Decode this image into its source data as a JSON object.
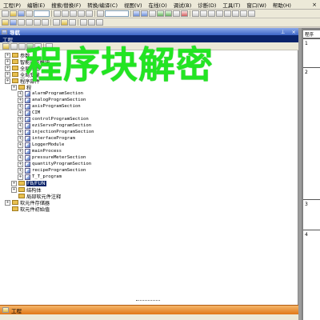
{
  "menubar": {
    "items": [
      "工程(P)",
      "编辑(E)",
      "搜索/替换(F)",
      "转换/编译(C)",
      "视图(V)",
      "在线(O)",
      "调试(B)",
      "诊断(D)",
      "工具(T)",
      "窗口(W)",
      "帮助(H)"
    ],
    "close": "×"
  },
  "nav": {
    "title": "导航",
    "pin": "⊥",
    "close": "×",
    "project_label": "工程"
  },
  "tree": {
    "nodes": [
      {
        "label": "参数",
        "mono": false
      },
      {
        "label": "智能功能模块",
        "mono": false
      },
      {
        "label": "全局标签",
        "mono": false
      },
      {
        "label": "全局变量",
        "mono": false
      },
      {
        "label": "程序部件",
        "mono": false
      },
      {
        "label": "程",
        "mono": false
      },
      {
        "label": "alarmProgramSection",
        "mono": true
      },
      {
        "label": "analogProgramSection",
        "mono": true
      },
      {
        "label": "axisProgramSection",
        "mono": true
      },
      {
        "label": "CIM",
        "mono": true
      },
      {
        "label": "controlProgramSection",
        "mono": true
      },
      {
        "label": "eziServoProgramSection",
        "mono": true
      },
      {
        "label": "injectionProgramSection",
        "mono": true
      },
      {
        "label": "interfaceProgram",
        "mono": true
      },
      {
        "label": "LoggerModule",
        "mono": true
      },
      {
        "label": "mainProcess",
        "mono": true
      },
      {
        "label": "pressureMeterSection",
        "mono": true
      },
      {
        "label": "quantityProgramSection",
        "mono": true
      },
      {
        "label": "recipeProgramSection",
        "mono": true
      },
      {
        "label": "T_T_program",
        "mono": true
      },
      {
        "label": "FB/FUN",
        "mono": false
      },
      {
        "label": "结构体",
        "mono": false
      },
      {
        "label": "局部软元件注释",
        "mono": false
      },
      {
        "label": "软元件存储器",
        "mono": false
      },
      {
        "label": "软元件初始值",
        "mono": false
      }
    ]
  },
  "watermark": "程序块解密",
  "bottom": {
    "label": "工程"
  },
  "editor": {
    "tab_label": "程序",
    "net_numbers": [
      "1",
      "2",
      "3",
      "4"
    ]
  },
  "colors": {
    "watermark": "#22e522",
    "nav_header": "#3d66c7",
    "selection": "#0a246a",
    "bottom_bar": "#e07818"
  }
}
